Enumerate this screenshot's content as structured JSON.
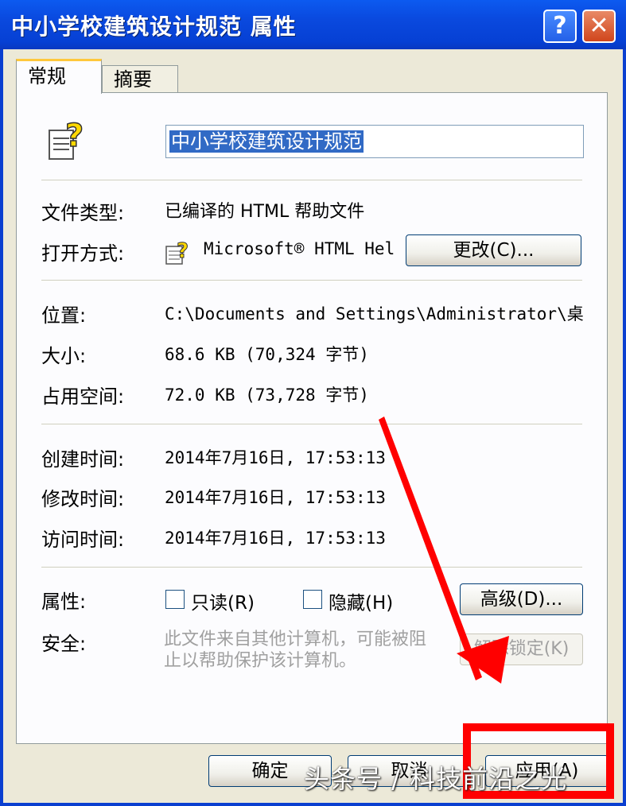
{
  "window": {
    "title": "中小学校建筑设计规范 属性"
  },
  "tabs": [
    {
      "label": "常规"
    },
    {
      "label": "摘要"
    }
  ],
  "general": {
    "file_name": "中小学校建筑设计规范",
    "type_label": "文件类型:",
    "type_value": "已编译的 HTML 帮助文件",
    "opens_with_label": "打开方式:",
    "opens_with_value": "Microsoft® HTML Hel",
    "change_button": "更改(C)...",
    "location_label": "位置:",
    "location_value": "C:\\Documents and Settings\\Administrator\\桌",
    "size_label": "大小:",
    "size_value": "68.6 KB (70,324 字节)",
    "size_on_disk_label": "占用空间:",
    "size_on_disk_value": "72.0 KB (73,728 字节)",
    "created_label": "创建时间:",
    "created_value": "2014年7月16日, 17:53:13",
    "modified_label": "修改时间:",
    "modified_value": "2014年7月16日, 17:53:13",
    "accessed_label": "访问时间:",
    "accessed_value": "2014年7月16日, 17:53:13",
    "attributes_label": "属性:",
    "readonly_label": "只读(R)",
    "hidden_label": "隐藏(H)",
    "advanced_button": "高级(D)...",
    "security_label": "安全:",
    "security_text": "此文件来自其他计算机，可能被阻止以帮助保护该计算机。",
    "unblock_button": "解除锁定(K)"
  },
  "footer": {
    "ok_button": "确定",
    "cancel_button": "取消",
    "apply_button": "应用(A)"
  },
  "watermark": "头条号 / 科技前沿之光",
  "colors": {
    "titlebar": "#0A49DE",
    "dialog": "#ECE9D8",
    "annotation": "#FF0000"
  }
}
